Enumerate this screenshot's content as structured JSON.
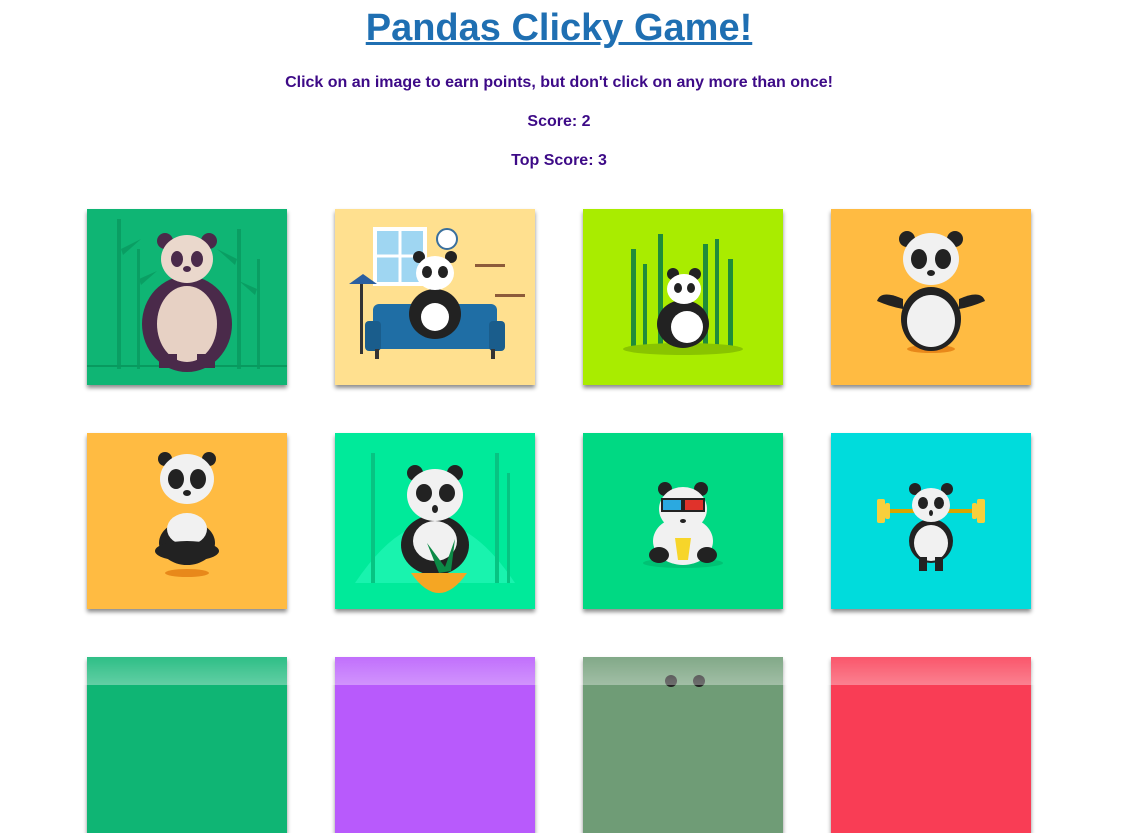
{
  "header": {
    "title": "Pandas Clicky Game!",
    "instructions": "Click on an image to earn points, but don't click on any more than once!",
    "score_text": "Score: 2",
    "top_score_text": "Top Score: 3"
  },
  "game": {
    "score": 2,
    "top_score": 3
  },
  "cards": [
    {
      "image": "standing-panda",
      "bg": "#0fb574"
    },
    {
      "image": "panda-on-sofa",
      "bg": "#ffe08f"
    },
    {
      "image": "panda-in-bamboo",
      "bg": "#a9ec00"
    },
    {
      "image": "panda-arms-out",
      "bg": "#ffbb42"
    },
    {
      "image": "meditating-panda",
      "bg": "#ffbb42"
    },
    {
      "image": "panda-with-pot",
      "bg": "#00ea9a"
    },
    {
      "image": "panda-3d-glasses",
      "bg": "#00d983"
    },
    {
      "image": "panda-weightlifting",
      "bg": "#00dcdc"
    },
    {
      "image": "panda-card-9",
      "bg": "#0fb574"
    },
    {
      "image": "panda-card-10",
      "bg": "#b85afc"
    },
    {
      "image": "panda-card-11",
      "bg": "#6f9c76"
    },
    {
      "image": "panda-card-12",
      "bg": "#f93d55"
    }
  ]
}
